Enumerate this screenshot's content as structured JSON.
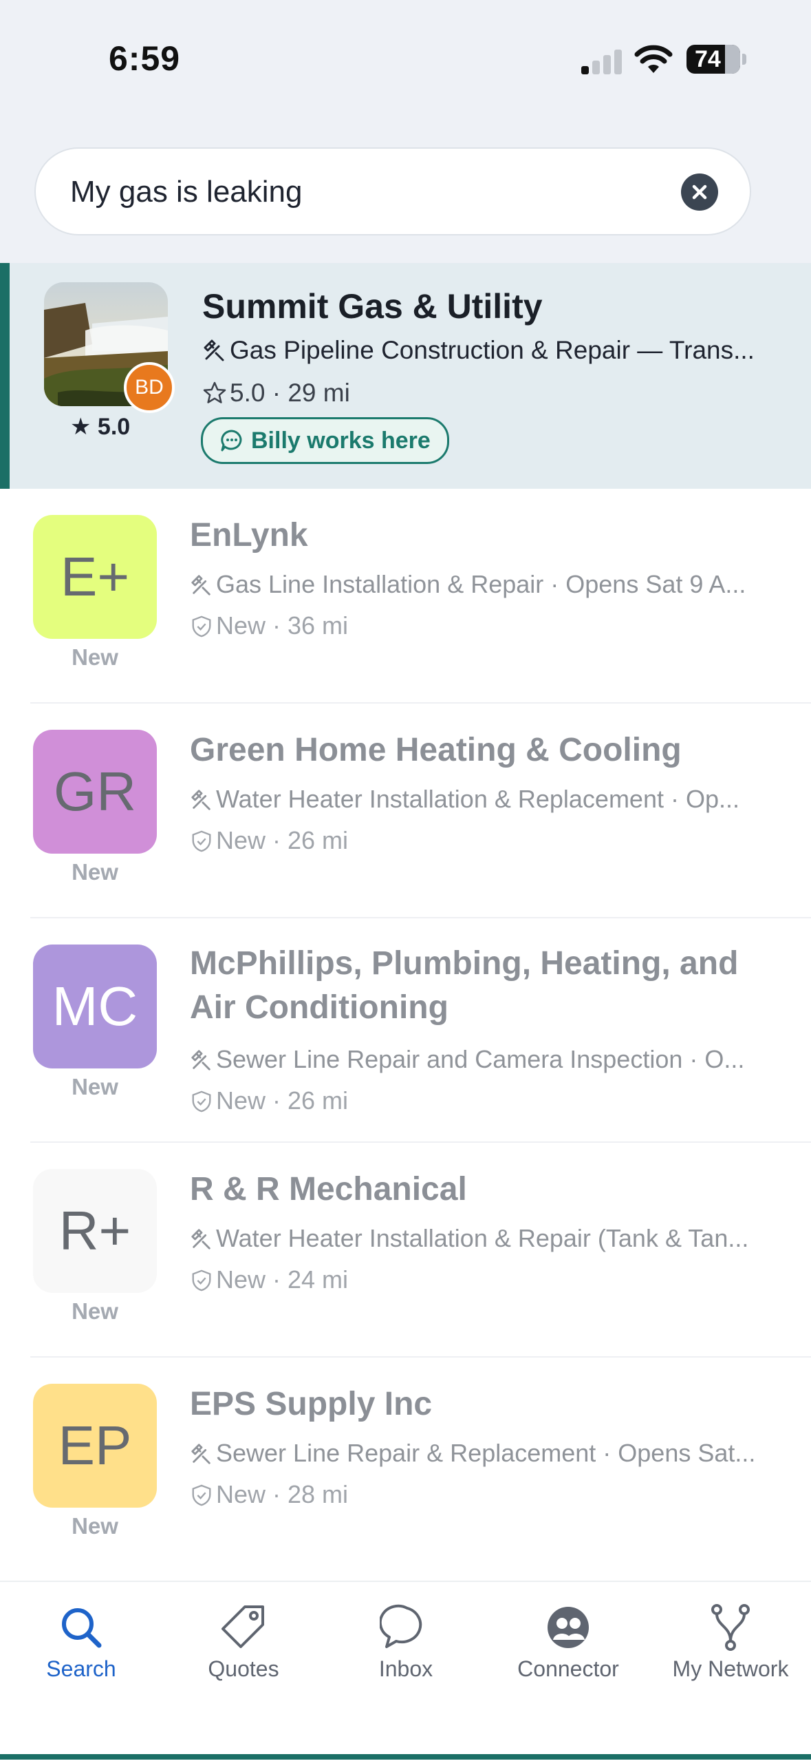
{
  "status": {
    "time": "6:59",
    "battery": "74"
  },
  "search": {
    "query": "My gas is leaking"
  },
  "featured": {
    "name": "Summit Gas & Utility",
    "category": "Gas Pipeline Construction & Repair — Trans...",
    "meta": "5.0 · 29 mi",
    "badge": "BD",
    "rating": "★ 5.0",
    "works_here": "Billy works here",
    "accent": "#1b6f66"
  },
  "results": [
    {
      "initials": "E+",
      "color": "#e4fe7e",
      "new_label": "New",
      "name": "EnLynk",
      "category": "Gas Line Installation & Repair · Opens Sat 9 A...",
      "meta": "New · 36 mi"
    },
    {
      "initials": "GR",
      "color": "#d08fd8",
      "new_label": "New",
      "name": "Green Home Heating & Cooling",
      "category": "Water Heater Installation & Replacement · Op...",
      "meta": "New · 26 mi"
    },
    {
      "initials": "MC",
      "color": "#ad96dc",
      "new_label": "New",
      "name": "McPhillips, Plumbing, Heating, and Air Conditioning",
      "category": "Sewer Line Repair and Camera Inspection · O...",
      "meta": "New · 26 mi"
    },
    {
      "initials": "R+",
      "color": "#f8f8f8",
      "new_label": "New",
      "name": "R & R Mechanical",
      "category": "Water Heater Installation & Repair (Tank & Tan...",
      "meta": "New · 24 mi"
    },
    {
      "initials": "EP",
      "color": "#ffe08a",
      "new_label": "New",
      "name": "EPS Supply Inc",
      "category": "Sewer Line Repair & Replacement · Opens Sat...",
      "meta": "New · 28 mi"
    }
  ],
  "tabs": [
    {
      "label": "Search",
      "icon": "search-icon",
      "active": true
    },
    {
      "label": "Quotes",
      "icon": "tag-icon"
    },
    {
      "label": "Inbox",
      "icon": "chat-icon"
    },
    {
      "label": "Connector",
      "icon": "people-icon"
    },
    {
      "label": "My Network",
      "icon": "network-icon"
    }
  ]
}
